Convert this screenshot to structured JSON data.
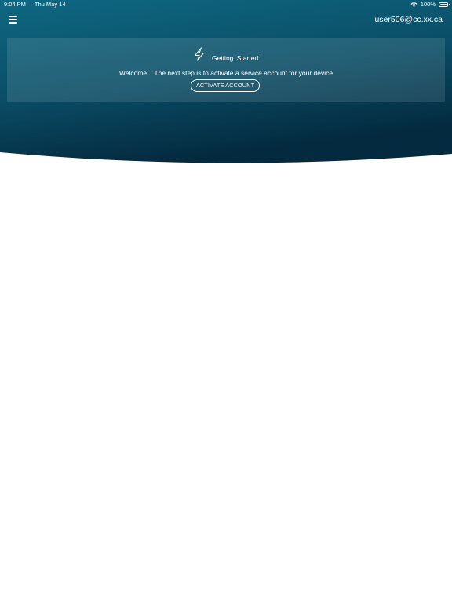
{
  "status_bar": {
    "time": "9:04 PM",
    "date": "Thu May 14",
    "battery": "100%",
    "battery_level": 1.0,
    "wifi_icon": "wifi-icon",
    "battery_icon": "battery-icon"
  },
  "header": {
    "menu_icon": "hamburger-menu-icon",
    "user_email": "user506@cc.xx.ca"
  },
  "getting_started": {
    "icon": "lightning-bolt-icon",
    "title": "Getting  Started",
    "message": "Welcome!   The next step is to activate a service account for your device",
    "button_label": "ACTIVATE ACCOUNT"
  },
  "colors": {
    "hero_top": "#0f6882",
    "hero_bottom": "#052f45",
    "text": "#ffffff",
    "background": "#ffffff"
  }
}
